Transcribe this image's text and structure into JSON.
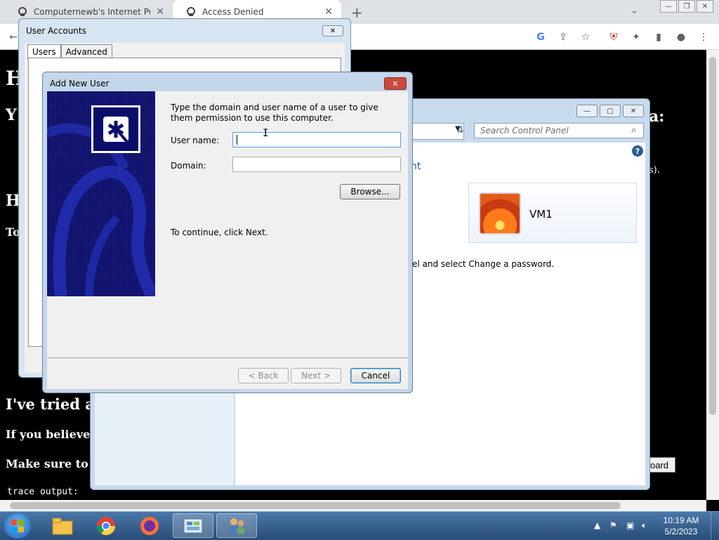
{
  "browser": {
    "tabs": [
      {
        "title": "Computernewb's Internet Pub H",
        "active": false
      },
      {
        "title": "Access Denied",
        "active": true
      }
    ],
    "new_tab": "+"
  },
  "page": {
    "headings": [
      {
        "text": "H",
        "size": "big"
      },
      {
        "text": "Y",
        "size": "mid"
      },
      {
        "text": "H",
        "size": "mid"
      },
      {
        "text": "To",
        "size": "small"
      },
      {
        "text": "I've tried al",
        "size": "mid"
      },
      {
        "text": "If you believe t",
        "size": "small"
      },
      {
        "text": "Make sure to p",
        "size": "small"
      }
    ],
    "right_fragments": {
      "a": "a:",
      "s": "s)."
    },
    "trace": "trace output:",
    "board_button": "oard"
  },
  "control_panel": {
    "search_placeholder": "Search Control Panel",
    "link_fragment": "nt",
    "user_tile": "VM1",
    "instruction": "el and select Change a password."
  },
  "user_accounts": {
    "title": "User Accounts",
    "tabs": [
      "Users",
      "Advanced"
    ]
  },
  "dialog": {
    "title": "Add New User",
    "intro": "Type the domain and user name of a user to give them permission to use this computer.",
    "username_label": "User name:",
    "username_value": "",
    "domain_label": "Domain:",
    "domain_value": "",
    "browse_label": "Browse...",
    "continue_text": "To continue, click Next.",
    "back_label": "< Back",
    "next_label": "Next >",
    "cancel_label": "Cancel"
  },
  "taskbar": {
    "time": "10:19 AM",
    "date": "5/2/2023"
  }
}
